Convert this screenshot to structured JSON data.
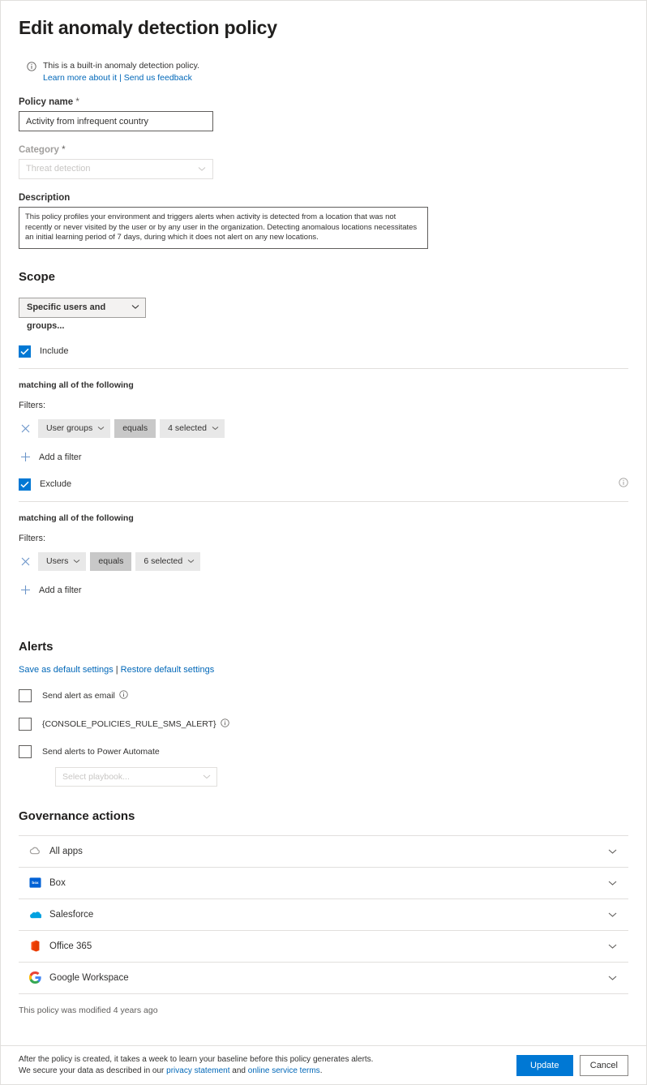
{
  "header": {
    "title": "Edit anomaly detection policy",
    "info_icon": "info-circle-icon",
    "banner_text": "This is a built-in anomaly detection policy.",
    "learn_more_link": "Learn more about it",
    "separator": "|",
    "feedback_link": "Send us feedback"
  },
  "policy_name": {
    "label": "Policy name",
    "required_mark": "*",
    "value": "Activity from infrequent country"
  },
  "category": {
    "label": "Category",
    "required_mark": "*",
    "value": "Threat detection",
    "chevron_icon": "chevron-down-icon"
  },
  "description": {
    "label": "Description",
    "value": "This policy profiles your environment and triggers alerts when activity is detected from a location that was not recently or never visited by the user or by any user in the organization. Detecting anomalous locations necessitates an initial learning period of 7 days, during which it does not alert on any new locations."
  },
  "scope": {
    "heading": "Scope",
    "selector_value": "Specific users and groups...",
    "chevron_icon": "chevron-down-icon",
    "include": {
      "label": "Include",
      "checked": true,
      "matching_text": "matching all of the following",
      "filters_label": "Filters:",
      "remove_icon": "close-x-icon",
      "filter": {
        "field": "User groups",
        "operator": "equals",
        "value": "4 selected"
      },
      "add_filter_label": "Add a filter",
      "add_icon": "plus-icon"
    },
    "exclude": {
      "label": "Exclude",
      "checked": true,
      "info_icon": "info-circle-icon",
      "matching_text": "matching all of the following",
      "filters_label": "Filters:",
      "remove_icon": "close-x-icon",
      "filter": {
        "field": "Users",
        "operator": "equals",
        "value": "6 selected"
      },
      "add_filter_label": "Add a filter",
      "add_icon": "plus-icon"
    }
  },
  "alerts": {
    "heading": "Alerts",
    "save_defaults_link": "Save as default settings",
    "separator": "|",
    "restore_defaults_link": "Restore default settings",
    "options": [
      {
        "label": "Send alert as email",
        "checked": false,
        "info_icon": "info-circle-icon"
      },
      {
        "label": "{CONSOLE_POLICIES_RULE_SMS_ALERT}",
        "checked": false,
        "info_icon": "info-circle-icon"
      },
      {
        "label": "Send alerts to Power Automate",
        "checked": false
      }
    ],
    "playbook_placeholder": "Select playbook...",
    "playbook_chevron_icon": "chevron-down-icon"
  },
  "governance": {
    "heading": "Governance actions",
    "rows": [
      {
        "label": "All apps",
        "icon": "all-apps-cloud-icon",
        "chevron_icon": "chevron-down-icon"
      },
      {
        "label": "Box",
        "icon": "box-icon",
        "chevron_icon": "chevron-down-icon"
      },
      {
        "label": "Salesforce",
        "icon": "salesforce-cloud-icon",
        "chevron_icon": "chevron-down-icon"
      },
      {
        "label": "Office 365",
        "icon": "office-365-icon",
        "chevron_icon": "chevron-down-icon"
      },
      {
        "label": "Google Workspace",
        "icon": "google-workspace-icon",
        "chevron_icon": "chevron-down-icon"
      }
    ]
  },
  "footer": {
    "modified_note": "This policy was modified 4 years ago",
    "line1": "After the policy is created, it takes a week to learn your baseline before this policy generates alerts.",
    "line2_pre": "We secure your data as described in our ",
    "privacy_link": "privacy statement",
    "line2_mid": " and ",
    "terms_link": "online service terms",
    "line2_end": ".",
    "update_button": "Update",
    "cancel_button": "Cancel"
  },
  "colors": {
    "accent": "#0078d4",
    "link": "#0067b8",
    "pill_bg": "#e8e8e8",
    "pill_op_bg": "#c8c8c8",
    "border": "#e1dfdd"
  }
}
